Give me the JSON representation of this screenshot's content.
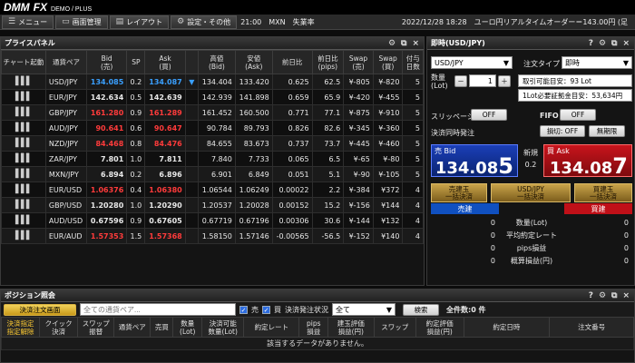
{
  "app": {
    "logo_main": "DMM",
    "logo_fx": "FX",
    "logo_sub": "DEMO / PLUS"
  },
  "menubar": {
    "items": [
      {
        "label": "メニュー",
        "icon": "menu-icon"
      },
      {
        "label": "画面管理",
        "icon": "window-icon"
      },
      {
        "label": "レイアウト",
        "icon": "layout-icon"
      },
      {
        "label": "設定・その他",
        "icon": "gear-icon"
      }
    ],
    "news": "21:00　MXN　失業率",
    "datetime": "2022/12/28 18:28　ユーロ円リアルタイムオーダー＝143.00円 (足"
  },
  "price_panel": {
    "title": "プライスパネル",
    "columns": [
      "チャート起動",
      "通貨ペア",
      "Bid\n(売)",
      "SP",
      "Ask\n(買)",
      "",
      "高値\n(Bid)",
      "安値\n(Ask)",
      "前日比",
      "前日比\n(pips)",
      "Swap\n(売)",
      "Swap\n(買)",
      "付与\n日数"
    ],
    "rows": [
      {
        "pair": "USD/JPY",
        "bid": "134.085",
        "sp": "0.2",
        "ask": "134.087",
        "dir": "▼",
        "high": "134.404",
        "low": "133.420",
        "change": "0.625",
        "pips": "62.5",
        "swap_sell": "¥-805",
        "swap_buy": "¥-820",
        "days": "5",
        "color": "blue"
      },
      {
        "pair": "EUR/JPY",
        "bid": "142.634",
        "sp": "0.5",
        "ask": "142.639",
        "dir": "",
        "high": "142.939",
        "low": "141.898",
        "change": "0.659",
        "pips": "65.9",
        "swap_sell": "¥-420",
        "swap_buy": "¥-455",
        "days": "5",
        "color": "white"
      },
      {
        "pair": "GBP/JPY",
        "bid": "161.280",
        "sp": "0.9",
        "ask": "161.289",
        "dir": "",
        "high": "161.452",
        "low": "160.500",
        "change": "0.771",
        "pips": "77.1",
        "swap_sell": "¥-875",
        "swap_buy": "¥-910",
        "days": "5",
        "color": "red"
      },
      {
        "pair": "AUD/JPY",
        "bid": "90.641",
        "sp": "0.6",
        "ask": "90.647",
        "dir": "",
        "high": "90.784",
        "low": "89.793",
        "change": "0.826",
        "pips": "82.6",
        "swap_sell": "¥-345",
        "swap_buy": "¥-360",
        "days": "5",
        "color": "red"
      },
      {
        "pair": "NZD/JPY",
        "bid": "84.468",
        "sp": "0.8",
        "ask": "84.476",
        "dir": "",
        "high": "84.655",
        "low": "83.673",
        "change": "0.737",
        "pips": "73.7",
        "swap_sell": "¥-445",
        "swap_buy": "¥-460",
        "days": "5",
        "color": "red"
      },
      {
        "pair": "ZAR/JPY",
        "bid": "7.801",
        "sp": "1.0",
        "ask": "7.811",
        "dir": "",
        "high": "7.840",
        "low": "7.733",
        "change": "0.065",
        "pips": "6.5",
        "swap_sell": "¥-65",
        "swap_buy": "¥-80",
        "days": "5",
        "color": "white"
      },
      {
        "pair": "MXN/JPY",
        "bid": "6.894",
        "sp": "0.2",
        "ask": "6.896",
        "dir": "",
        "high": "6.901",
        "low": "6.849",
        "change": "0.051",
        "pips": "5.1",
        "swap_sell": "¥-90",
        "swap_buy": "¥-105",
        "days": "5",
        "color": "white"
      },
      {
        "pair": "EUR/USD",
        "bid": "1.06376",
        "sp": "0.4",
        "ask": "1.06380",
        "dir": "",
        "high": "1.06544",
        "low": "1.06249",
        "change": "0.00022",
        "pips": "2.2",
        "swap_sell": "¥-384",
        "swap_buy": "¥372",
        "days": "4",
        "color": "red"
      },
      {
        "pair": "GBP/USD",
        "bid": "1.20280",
        "sp": "1.0",
        "ask": "1.20290",
        "dir": "",
        "high": "1.20537",
        "low": "1.20028",
        "change": "0.00152",
        "pips": "15.2",
        "swap_sell": "¥-156",
        "swap_buy": "¥144",
        "days": "4",
        "color": "white"
      },
      {
        "pair": "AUD/USD",
        "bid": "0.67596",
        "sp": "0.9",
        "ask": "0.67605",
        "dir": "",
        "high": "0.67719",
        "low": "0.67196",
        "change": "0.00306",
        "pips": "30.6",
        "swap_sell": "¥-144",
        "swap_buy": "¥132",
        "days": "4",
        "color": "white"
      },
      {
        "pair": "EUR/AUD",
        "bid": "1.57353",
        "sp": "1.5",
        "ask": "1.57368",
        "dir": "",
        "high": "1.58150",
        "low": "1.57146",
        "change": "-0.00565",
        "pips": "-56.5",
        "swap_sell": "¥-152",
        "swap_buy": "¥140",
        "days": "4",
        "color": "red"
      }
    ]
  },
  "order_panel": {
    "title": "即時(USD/JPY)",
    "pair_select": "USD/JPY",
    "order_type_label": "注文タイプ",
    "order_type_value": "即時",
    "lot_label": "数量\n(Lot)",
    "lot_minus": "－",
    "lot_value": "1",
    "lot_plus": "＋",
    "info1": "取引可能目安：93 Lot",
    "info2": "1Lot必要証拠金目安：53,634円",
    "slippage_label": "スリッページ",
    "slippage_value": "OFF",
    "fifo_label": "FIFO",
    "fifo_value": "OFF",
    "settle_label": "決済同時発注",
    "stoploss_btn": "損切: OFF",
    "unlimited_btn": "無期限",
    "sell_label": "売 Bid",
    "sell_price_main": "134.08",
    "sell_price_big": "5",
    "spread_label": "新規",
    "spread_value": "0.2",
    "buy_label": "買 Ask",
    "buy_price_main": "134.08",
    "buy_price_big": "7",
    "sell_settle": "売建玉\n一括決済",
    "all_settle": "USD/JPY\n一括決済",
    "buy_settle": "買建玉\n一括決済",
    "sell_header": "売建",
    "buy_header": "買建",
    "summary": [
      {
        "label": "数量(Lot)",
        "sell": "0",
        "buy": "0"
      },
      {
        "label": "平均約定レート",
        "sell": "0",
        "buy": "0"
      },
      {
        "label": "pips損益",
        "sell": "0",
        "buy": "0"
      },
      {
        "label": "概算損益(円)",
        "sell": "0",
        "buy": "0"
      }
    ]
  },
  "position_panel": {
    "title": "ポジション照会",
    "settle_order_btn": "決済注文画面",
    "pair_filter_placeholder": "全ての通貨ペア...",
    "sell_check": "売",
    "buy_check": "買",
    "status_label": "決済発注状況",
    "status_value": "全て",
    "search_btn": "検索",
    "total_count": "全件数:0 件",
    "columns": [
      "決済指定\n指定解除",
      "クイック\n決済",
      "スワップ\n振替",
      "通貨ペア",
      "売買",
      "数量\n(Lot)",
      "決済可能\n数量(Lot)",
      "約定レート",
      "pips\n損益",
      "建玉評価\n損益(円)",
      "スワップ",
      "約定評価\n損益(円)",
      "約定日時",
      "注文番号"
    ],
    "empty_message": "該当するデータがありません。"
  },
  "colors": {
    "bid_blue": "#3aa0ff",
    "down_red": "#ff3b3b",
    "sell_button": "#1b3fb8",
    "buy_button": "#c8141c",
    "gold_button": "#c9a44a"
  }
}
